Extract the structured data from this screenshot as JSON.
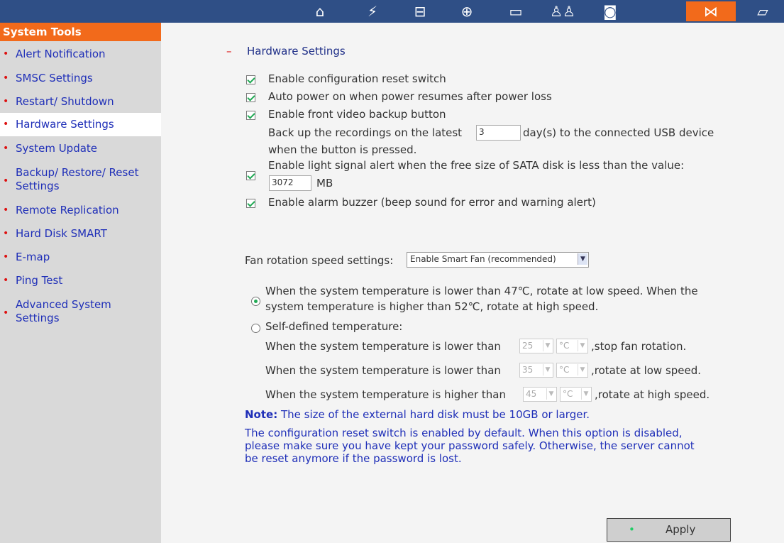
{
  "topbar": {
    "icons": [
      "home-icon",
      "network-icon",
      "devices-icon",
      "power-icon",
      "storage-icon",
      "users-icon",
      "camera-icon",
      "system-tools-icon",
      "log-icon"
    ],
    "active_color": "#f26a1b",
    "bg_color": "#2f4f86"
  },
  "sidebar": {
    "header": "System Tools",
    "items": [
      {
        "label": "Alert Notification"
      },
      {
        "label": "SMSC Settings"
      },
      {
        "label": "Restart/ Shutdown"
      },
      {
        "label": "Hardware Settings"
      },
      {
        "label": "System Update"
      },
      {
        "label": "Backup/ Restore/ Reset Settings"
      },
      {
        "label": "Remote Replication"
      },
      {
        "label": "Hard Disk SMART"
      },
      {
        "label": "E-map"
      },
      {
        "label": "Ping Test"
      },
      {
        "label": "Advanced System Settings"
      }
    ]
  },
  "main": {
    "section_title": "Hardware Settings",
    "options": {
      "reset_switch": "Enable configuration reset switch",
      "auto_power": "Auto power on when power resumes after power loss",
      "front_backup": "Enable front video backup button",
      "backup_pre": "Back up the recordings on the latest",
      "backup_days": "3",
      "backup_post": "day(s) to the connected USB device",
      "backup_line2": "when the button is pressed.",
      "light_alert": "Enable light signal alert when the free size of SATA disk is less than the value:",
      "light_value": "3072",
      "light_unit": "MB",
      "alarm_buzzer": "Enable alarm buzzer (beep sound for error and warning alert)"
    },
    "fan": {
      "label": "Fan rotation speed settings:",
      "selected": "Enable Smart Fan (recommended)",
      "radio_smart_line1": "When the system temperature is lower than 47℃, rotate at low speed. When the",
      "radio_smart_line2": "system temperature is higher than 52℃, rotate at high speed.",
      "radio_custom": "Self-defined temperature:",
      "row1_pre": "When the system temperature is lower than",
      "row1_val": "25",
      "row1_unit": "°C",
      "row1_post": ",stop fan rotation.",
      "row2_pre": "When the system temperature is lower than",
      "row2_val": "35",
      "row2_unit": "°C",
      "row2_post": ",rotate at low speed.",
      "row3_pre": "When the system temperature is higher than",
      "row3_val": "45",
      "row3_unit": "°C",
      "row3_post": ",rotate at high speed."
    },
    "note_label": "Note:",
    "note_text": "The size of the external hard disk must be 10GB or larger.",
    "info_line1": "The configuration reset switch is enabled by default. When this option is disabled,",
    "info_line2": "please make sure you have kept your password safely. Otherwise, the server cannot",
    "info_line3": "be reset anymore if the password is lost.",
    "apply_label": "Apply"
  }
}
